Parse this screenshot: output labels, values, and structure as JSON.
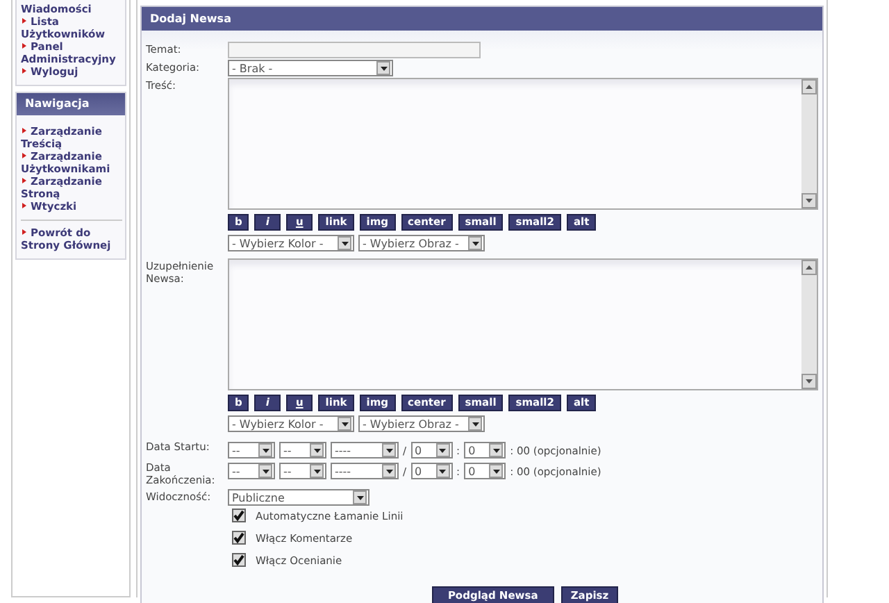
{
  "sidebar": [
    {
      "items": [
        {
          "label": "Wiadomości",
          "bullet": false
        },
        {
          "label": "Lista Użytkowników",
          "bullet": true
        },
        {
          "label": "Panel Administracyjny",
          "bullet": true
        },
        {
          "label": "Wyloguj",
          "bullet": true
        }
      ]
    },
    {
      "title": "Nawigacja",
      "groups": [
        [
          {
            "label": "Zarządzanie Treścią",
            "bullet": true
          },
          {
            "label": "Zarządzanie Użytkownikami",
            "bullet": true
          },
          {
            "label": "Zarządzanie Stroną",
            "bullet": true
          },
          {
            "label": "Wtyczki",
            "bullet": true
          }
        ],
        [
          {
            "label": "Powrót do Strony Głównej",
            "bullet": true
          }
        ]
      ]
    }
  ],
  "panel": {
    "title": "Dodaj Newsa",
    "rows": [
      {
        "kind": "text",
        "label": "Temat:"
      },
      {
        "kind": "select",
        "label": "Kategoria:",
        "value": "- Brak -"
      },
      {
        "kind": "editor",
        "label": "Treść:",
        "tools": [
          "b",
          "i",
          "u",
          "link",
          "img",
          "center",
          "small",
          "small2",
          "alt"
        ],
        "selects": [
          "- Wybierz Kolor -",
          "- Wybierz Obraz -"
        ]
      },
      {
        "kind": "editor",
        "label": "Uzupełnienie Newsa:",
        "tools": [
          "b",
          "i",
          "u",
          "link",
          "img",
          "center",
          "small",
          "small2",
          "alt"
        ],
        "selects": [
          "- Wybierz Kolor -",
          "- Wybierz Obraz -"
        ]
      },
      {
        "kind": "date",
        "label": "Data Startu:",
        "day": "--",
        "month": "--",
        "year": "----",
        "slash": "/",
        "hour": "0",
        "colon": ":",
        "minute": "0",
        "note": ": 00 (opcjonalnie)"
      },
      {
        "kind": "date",
        "label": "Data Zakończenia:",
        "day": "--",
        "month": "--",
        "year": "----",
        "slash": "/",
        "hour": "0",
        "colon": ":",
        "minute": "0",
        "note": ": 00 (opcjonalnie)"
      },
      {
        "kind": "select",
        "label": "Widoczność:",
        "value": "Publiczne"
      },
      {
        "kind": "checkbox",
        "label": "Automatyczne Łamanie Linii",
        "checked": true
      },
      {
        "kind": "checkbox",
        "label": "Włącz Komentarze",
        "checked": true
      },
      {
        "kind": "checkbox",
        "label": "Włącz Ocenianie",
        "checked": true
      }
    ],
    "buttons": [
      "Podgląd Newsa",
      "Zapisz"
    ]
  }
}
